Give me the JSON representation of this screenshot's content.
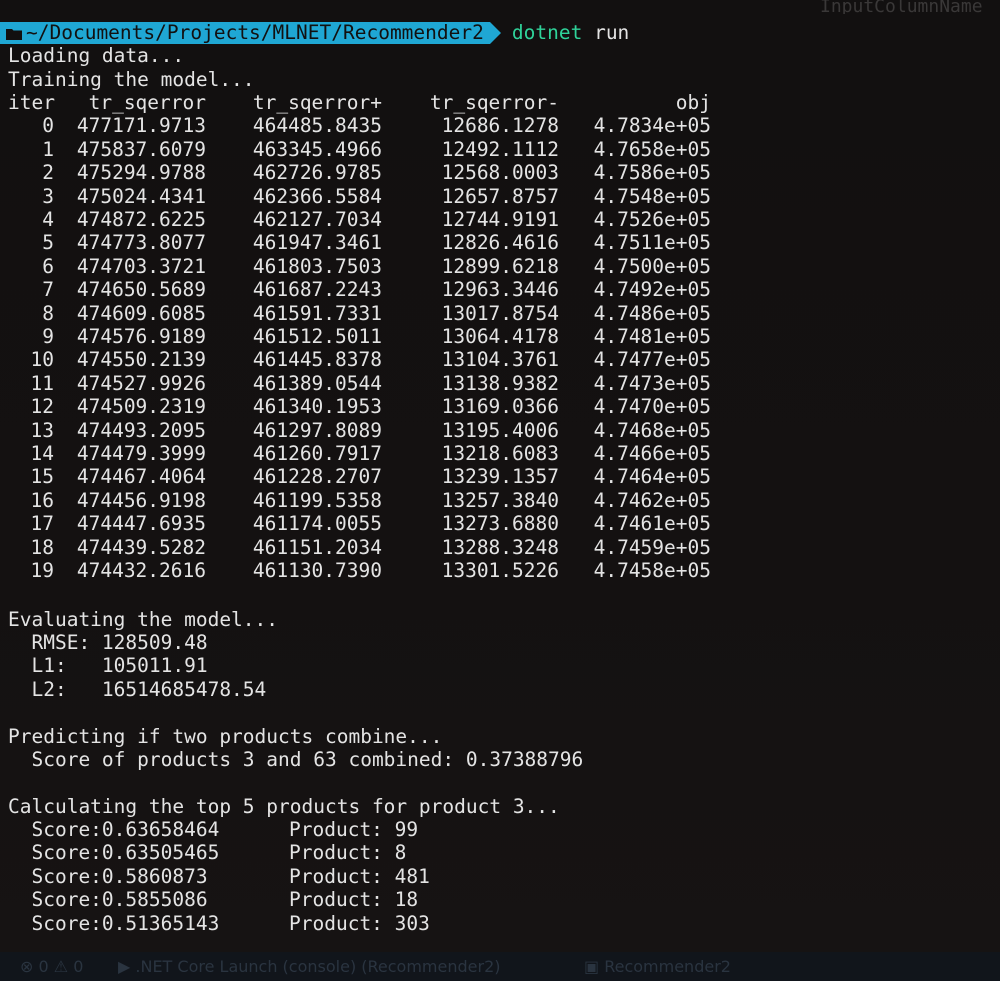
{
  "prompt": {
    "path": "~/Documents/Projects/MLNET/Recommender2",
    "command": "dotnet",
    "argument": "run",
    "folder_icon": "folder-icon",
    "bg_color": "#1fa7d4"
  },
  "ghost_title": "InputColumnName",
  "messages": {
    "loading": "Loading data...",
    "training": "Training the model...",
    "evaluating": "Evaluating the model...",
    "predicting": "Predicting if two products combine...",
    "score_line": "  Score of products 3 and 63 combined: 0.37388796",
    "calculating": "Calculating the top 5 products for product 3..."
  },
  "table": {
    "headers": [
      "iter",
      "tr_sqerror",
      "tr_sqerror+",
      "tr_sqerror-",
      "obj"
    ],
    "rows": [
      [
        "0",
        "477171.9713",
        "464485.8435",
        "12686.1278",
        "4.7834e+05"
      ],
      [
        "1",
        "475837.6079",
        "463345.4966",
        "12492.1112",
        "4.7658e+05"
      ],
      [
        "2",
        "475294.9788",
        "462726.9785",
        "12568.0003",
        "4.7586e+05"
      ],
      [
        "3",
        "475024.4341",
        "462366.5584",
        "12657.8757",
        "4.7548e+05"
      ],
      [
        "4",
        "474872.6225",
        "462127.7034",
        "12744.9191",
        "4.7526e+05"
      ],
      [
        "5",
        "474773.8077",
        "461947.3461",
        "12826.4616",
        "4.7511e+05"
      ],
      [
        "6",
        "474703.3721",
        "461803.7503",
        "12899.6218",
        "4.7500e+05"
      ],
      [
        "7",
        "474650.5689",
        "461687.2243",
        "12963.3446",
        "4.7492e+05"
      ],
      [
        "8",
        "474609.6085",
        "461591.7331",
        "13017.8754",
        "4.7486e+05"
      ],
      [
        "9",
        "474576.9189",
        "461512.5011",
        "13064.4178",
        "4.7481e+05"
      ],
      [
        "10",
        "474550.2139",
        "461445.8378",
        "13104.3761",
        "4.7477e+05"
      ],
      [
        "11",
        "474527.9926",
        "461389.0544",
        "13138.9382",
        "4.7473e+05"
      ],
      [
        "12",
        "474509.2319",
        "461340.1953",
        "13169.0366",
        "4.7470e+05"
      ],
      [
        "13",
        "474493.2095",
        "461297.8089",
        "13195.4006",
        "4.7468e+05"
      ],
      [
        "14",
        "474479.3999",
        "461260.7917",
        "13218.6083",
        "4.7466e+05"
      ],
      [
        "15",
        "474467.4064",
        "461228.2707",
        "13239.1357",
        "4.7464e+05"
      ],
      [
        "16",
        "474456.9198",
        "461199.5358",
        "13257.3840",
        "4.7462e+05"
      ],
      [
        "17",
        "474447.6935",
        "461174.0055",
        "13273.6880",
        "4.7461e+05"
      ],
      [
        "18",
        "474439.5282",
        "461151.2034",
        "13288.3248",
        "4.7459e+05"
      ],
      [
        "19",
        "474432.2616",
        "461130.7390",
        "13301.5226",
        "4.7458e+05"
      ]
    ]
  },
  "metrics": [
    {
      "label": "  RMSE: ",
      "value": "128509.48"
    },
    {
      "label": "  L1:   ",
      "value": "105011.91"
    },
    {
      "label": "  L2:   ",
      "value": "16514685478.54"
    }
  ],
  "top_products": [
    {
      "score": "  Score:0.63658464",
      "product": "Product: 99"
    },
    {
      "score": "  Score:0.63505465",
      "product": "Product: 8"
    },
    {
      "score": "  Score:0.5860873",
      "product": "Product: 481"
    },
    {
      "score": "  Score:0.5855086",
      "product": "Product: 18"
    },
    {
      "score": "  Score:0.51365143",
      "product": "Product: 303"
    }
  ],
  "statusbar": {
    "left": "⊗ 0  ⚠ 0",
    "launch": "▶ .NET Core Launch (console) (Recommender2)",
    "project": "▣ Recommender2"
  }
}
